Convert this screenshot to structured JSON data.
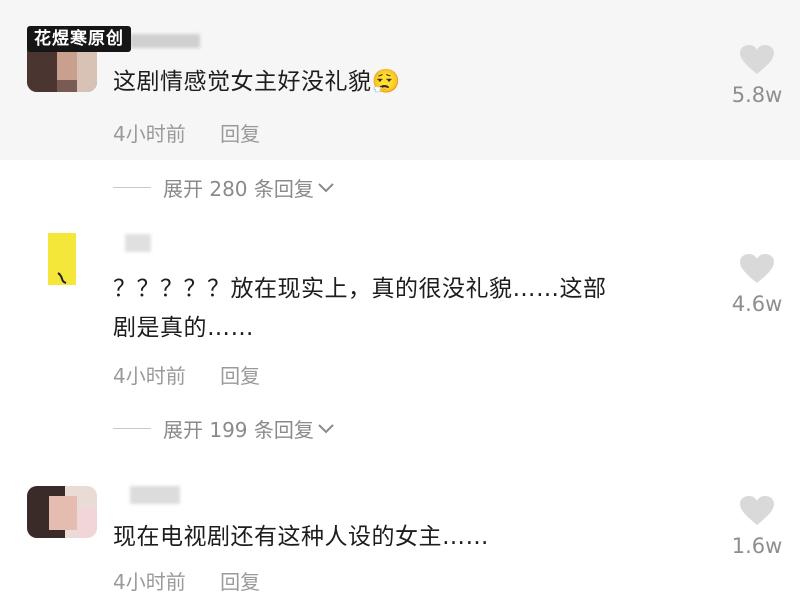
{
  "watermark": "花煜寒原创",
  "comments": [
    {
      "text": "这剧情感觉女主好没礼貌😮‍💨",
      "time": "4小时前",
      "reply": "回复",
      "likes": "5.8w",
      "expand": "展开 280 条回复"
    },
    {
      "text_line1": "？？？？？放在现实上，真的很没礼貌……这部",
      "text_line2": "剧是真的……",
      "time": "4小时前",
      "reply": "回复",
      "likes": "4.6w",
      "expand": "展开 199 条回复"
    },
    {
      "text": "现在电视剧还有这种人设的女主……",
      "time": "4小时前",
      "reply": "回复",
      "likes": "1.6w"
    }
  ],
  "icons": {
    "like": "heart-icon",
    "expand": "chevron-down-icon",
    "emoji": "sighing-face-emoji"
  },
  "colors": {
    "highlight_bg": "#f6f6f6",
    "meta_text": "#9a9a9a",
    "heart": "#d9d9d9"
  }
}
